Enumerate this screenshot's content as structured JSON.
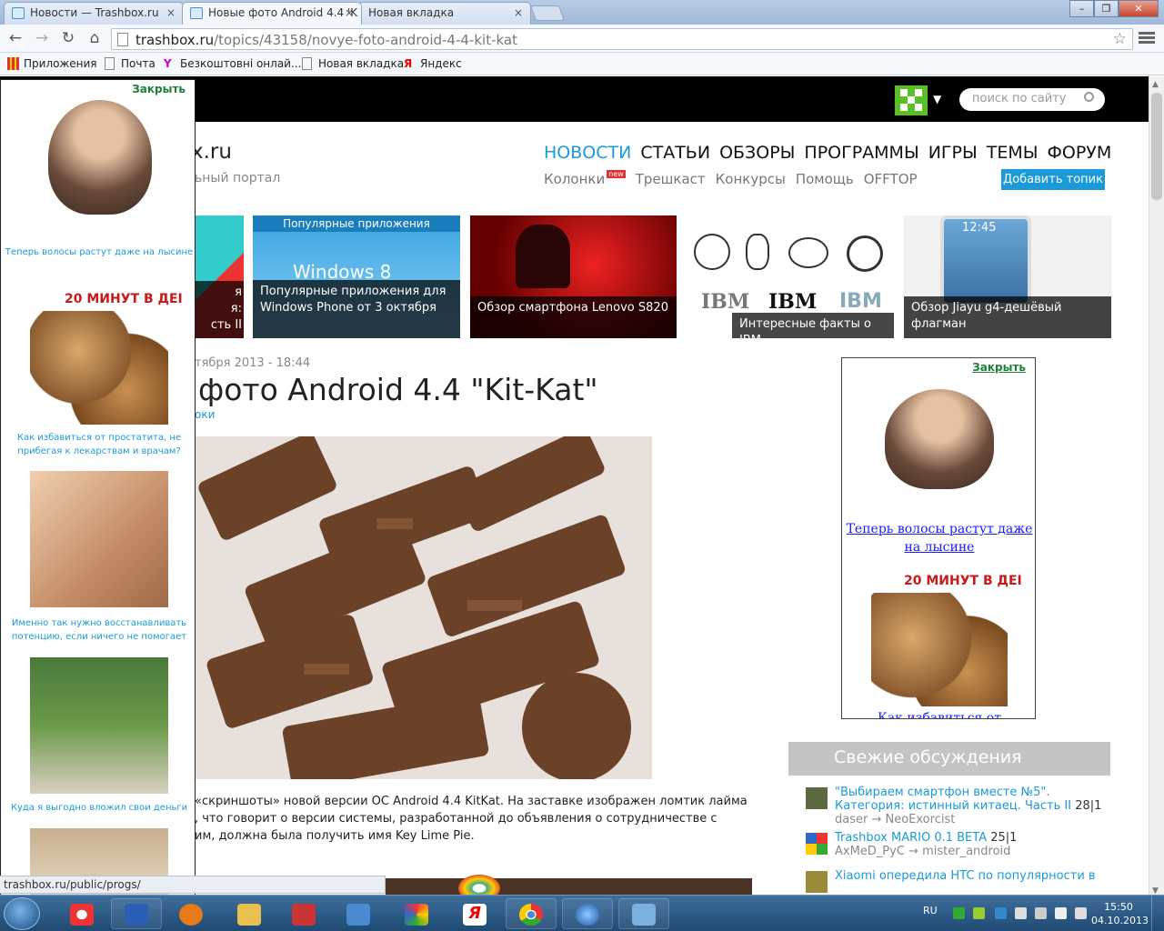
{
  "browser": {
    "tabs": [
      {
        "title": "Новости — Trashbox.ru",
        "close": "×",
        "active": false
      },
      {
        "title": "Новые фото Android 4.4 'K",
        "close": "×",
        "active": true
      },
      {
        "title": "Новая вкладка",
        "close": "×",
        "active": false
      }
    ],
    "url_domain": "trashbox.ru",
    "url_path": "/topics/43158/novye-foto-android-4-4-kit-kat",
    "bookmarks": [
      "Приложения",
      "Почта",
      "Безкоштовні онлай...",
      "Новая вкладка",
      "Яндекс"
    ],
    "status_url": "trashbox.ru/public/progs/"
  },
  "site": {
    "logo_fragment": "x.ru",
    "tagline_fragment": "ьный портал",
    "search_placeholder": "поиск по сайту",
    "nav": [
      "НОВОСТИ",
      "СТАТЬИ",
      "ОБЗОРЫ",
      "ПРОГРАММЫ",
      "ИГРЫ",
      "ТЕМЫ",
      "ФОРУМ"
    ],
    "subnav": [
      "Колонки",
      "Трешкаст",
      "Конкурсы",
      "Помощь",
      "OFFTOP"
    ],
    "new_badge": "new",
    "add_topic": "Добавить топик"
  },
  "tiles": [
    {
      "caption_l1": "я",
      "caption_l2": "я:",
      "caption_l3": "сть II"
    },
    {
      "banner": "Популярные приложения",
      "logo": "Windows 8",
      "caption": "Популярные приложения для Windows Phone от 3 октября"
    },
    {
      "caption": "Обзор смартфона Lenovo S820"
    },
    {
      "caption": "Интересные факты о IBM",
      "logos": [
        "IBM",
        "IBM",
        "IBM"
      ]
    },
    {
      "caption": "Обзор Jiayu g4-дешёвый флагман",
      "phone_time": "12:45"
    }
  ],
  "article": {
    "date": "тября 2013 - 18:44",
    "title": "фото Android 4.4 \"Kit-Kat\"",
    "tag": "оки",
    "text_lines": [
      "«скриншоты» новой версии ОС Android 4.4 KitKat. На заставке изображен ломтик лайма",
      ", что говорит о версии системы, разработанной до объявления о сотрудничестве с",
      "им, должна была получить имя Key Lime Pie."
    ]
  },
  "right_ad": {
    "close": "Закрыть",
    "text1": "Теперь волосы растут даже на лысине",
    "banner": "20 МИНУТ В ДЕІ",
    "text2": "Как избавиться от простатита"
  },
  "discussions": {
    "title": "Свежие обсуждения",
    "items": [
      {
        "title": "\"Выбираем смартфон вместе №5\". Категория: истинный китаец. Часть II",
        "count": "28|1",
        "users": "daser → NeoExorcist"
      },
      {
        "title": "Trashbox MARIO 0.1 BETA",
        "count": "25|1",
        "users": "AxMeD_PyC → mister_android"
      },
      {
        "title": "Xiaomi опередила HTC по популярности в",
        "count": "",
        "users": ""
      }
    ]
  },
  "left_ad": {
    "close": "Закрыть",
    "texts": [
      "Теперь волосы растут даже на лысине",
      "Как избавиться от простатита, не прибегая к лекарствам и врачам?",
      "Именно так нужно восстанавливать потенцию, если ничего не помогает",
      "Куда я выгодно вложил свои деньги"
    ],
    "banner": "20 МИНУТ В ДЕІ"
  },
  "taskbar": {
    "lang": "RU",
    "time": "15:50",
    "date": "04.10.2013"
  },
  "colors": {
    "accent": "#1a9ad8",
    "topbar": "#000000",
    "green": "#5bc026"
  }
}
